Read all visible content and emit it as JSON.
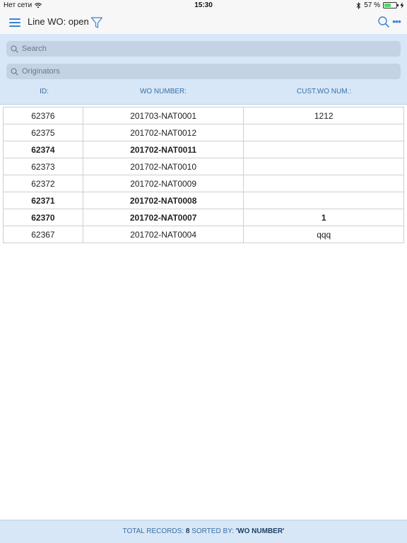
{
  "status_bar": {
    "carrier": "Нет сети",
    "time": "15:30",
    "battery_percent": "57 %",
    "battery_level": 0.57
  },
  "nav": {
    "title": "Line WO: open",
    "icons": [
      "menu-icon",
      "filter-icon",
      "search-icon",
      "more-icon"
    ]
  },
  "filters": {
    "search_placeholder": "Search",
    "originators_placeholder": "Originators"
  },
  "columns": {
    "id": "ID:",
    "wo_number": "WO NUMBER:",
    "cust_wo_num": "CUST.WO NUM.:"
  },
  "rows": [
    {
      "id": "62376",
      "wo_number": "201703-NAT0001",
      "cust_wo_num": "1212",
      "bold": false
    },
    {
      "id": "62375",
      "wo_number": "201702-NAT0012",
      "cust_wo_num": "",
      "bold": false
    },
    {
      "id": "62374",
      "wo_number": "201702-NAT0011",
      "cust_wo_num": "",
      "bold": true
    },
    {
      "id": "62373",
      "wo_number": "201702-NAT0010",
      "cust_wo_num": "",
      "bold": false
    },
    {
      "id": "62372",
      "wo_number": "201702-NAT0009",
      "cust_wo_num": "",
      "bold": false
    },
    {
      "id": "62371",
      "wo_number": "201702-NAT0008",
      "cust_wo_num": "",
      "bold": true
    },
    {
      "id": "62370",
      "wo_number": "201702-NAT0007",
      "cust_wo_num": "1",
      "bold": true
    },
    {
      "id": "62367",
      "wo_number": "201702-NAT0004",
      "cust_wo_num": "qqq",
      "bold": false
    }
  ],
  "footer": {
    "total_label": "TOTAL RECORDS:",
    "total_value": "8",
    "sorted_label": "SORTED BY:",
    "sorted_value": "'WO NUMBER'"
  },
  "colors": {
    "accent": "#3b82d6",
    "header_bg": "#d7e7f7",
    "field_bg": "#c3d3e3",
    "battery": "#4cd964"
  }
}
